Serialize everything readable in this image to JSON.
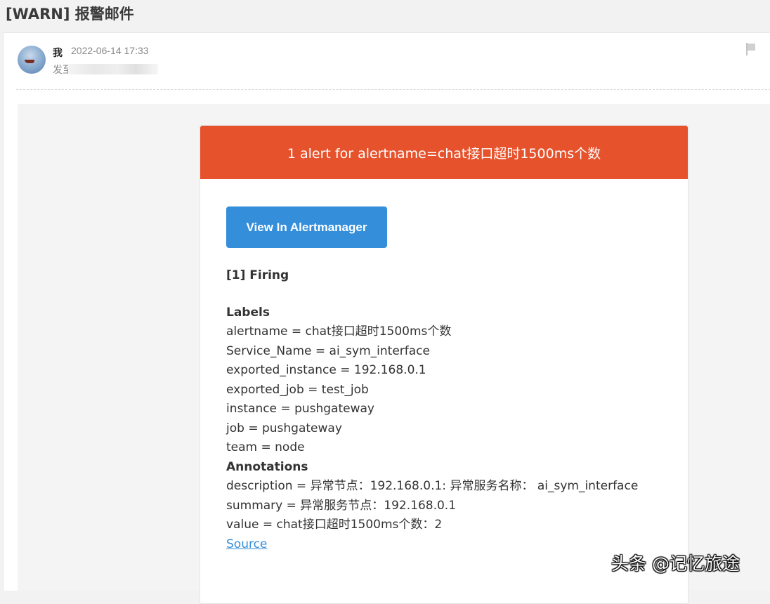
{
  "email": {
    "subject": "[WARN] 报警邮件",
    "sender_name": "我",
    "sent_time": "2022-06-14 17:33",
    "to_label": "发至"
  },
  "alert": {
    "header": "1 alert for alertname=chat接口超时1500ms个数",
    "button_label": "View In Alertmanager",
    "firing_label": "[1] Firing",
    "labels_heading": "Labels",
    "labels": [
      "alertname = chat接口超时1500ms个数",
      "Service_Name = ai_sym_interface",
      "exported_instance = 192.168.0.1",
      "exported_job = test_job",
      "instance = pushgateway",
      "job = pushgateway",
      "team = node"
    ],
    "annotations_heading": "Annotations",
    "annotations": [
      "description = 异常节点：192.168.0.1: 异常服务名称：  ai_sym_interface",
      "summary = 异常服务节点：192.168.0.1",
      "value = chat接口超时1500ms个数：2"
    ],
    "source_link": "Source"
  },
  "watermark": "头条 @记忆旅途",
  "colors": {
    "header_bg": "#e6522c",
    "button_bg": "#348eda",
    "link": "#348eda"
  },
  "icons": {
    "flag": "flag-icon",
    "avatar": "avatar"
  }
}
